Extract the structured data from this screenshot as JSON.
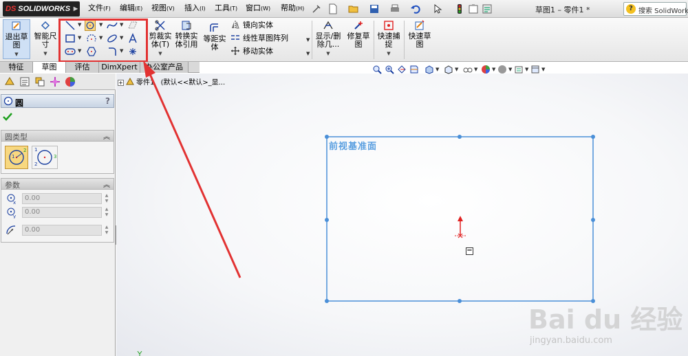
{
  "app": {
    "logo_prefix": "DS",
    "logo_text": "SOLIDWORKS",
    "document_title": "草图1 – 零件1 *",
    "search_placeholder": "搜索 SolidWorks"
  },
  "menu": [
    {
      "label": "文件",
      "accel": "(F)"
    },
    {
      "label": "编辑",
      "accel": "(E)"
    },
    {
      "label": "视图",
      "accel": "(V)"
    },
    {
      "label": "插入",
      "accel": "(I)"
    },
    {
      "label": "工具",
      "accel": "(T)"
    },
    {
      "label": "窗口",
      "accel": "(W)"
    },
    {
      "label": "帮助",
      "accel": "(H)"
    }
  ],
  "ribbon": {
    "exit_sketch": "退出草图",
    "smart_dimension": "智能尺寸",
    "trim_entities": "剪裁实体(T)",
    "convert_entities": "转换实体引用",
    "offset_entities": "等距实体",
    "mirror_entities": "镜向实体",
    "linear_pattern": "线性草图阵列",
    "move_entities": "移动实体",
    "display_delete": "显示/删除几...",
    "repair_sketch": "修复草图",
    "quick_snaps": "快速捕捉",
    "rapid_sketch": "快速草图"
  },
  "tabs": [
    {
      "label": "特征",
      "active": false
    },
    {
      "label": "草图",
      "active": true
    },
    {
      "label": "评估",
      "active": false
    },
    {
      "label": "DimXpert",
      "active": false
    },
    {
      "label": "办公室产品",
      "active": false
    }
  ],
  "property_manager": {
    "title": "圆",
    "help": "?",
    "group_circle_type": "圆类型",
    "group_parameters": "参数",
    "params": [
      {
        "icon": "center-x-icon",
        "value": "0.00"
      },
      {
        "icon": "center-y-icon",
        "value": "0.00"
      },
      {
        "icon": "radius-icon",
        "value": "0.00"
      }
    ],
    "circle_type_labels": {
      "center_a": "1",
      "center_b": "2",
      "perimeter_a": "1",
      "perimeter_b": "2",
      "perimeter_c": "3"
    }
  },
  "feature_tree": {
    "expand": "+",
    "root": "零件1",
    "config": "(默认<<默认>_显..."
  },
  "graphics": {
    "plane_label": "前视基准面",
    "minus_marker": "−"
  },
  "watermark": {
    "logo": "Bai du 经验",
    "url": "jingyan.baidu.com"
  },
  "colors": {
    "highlight": "#e23232",
    "sketch_blue": "#4a8fd8",
    "plane_label": "#5a9fe0",
    "origin_red": "#e02020"
  }
}
